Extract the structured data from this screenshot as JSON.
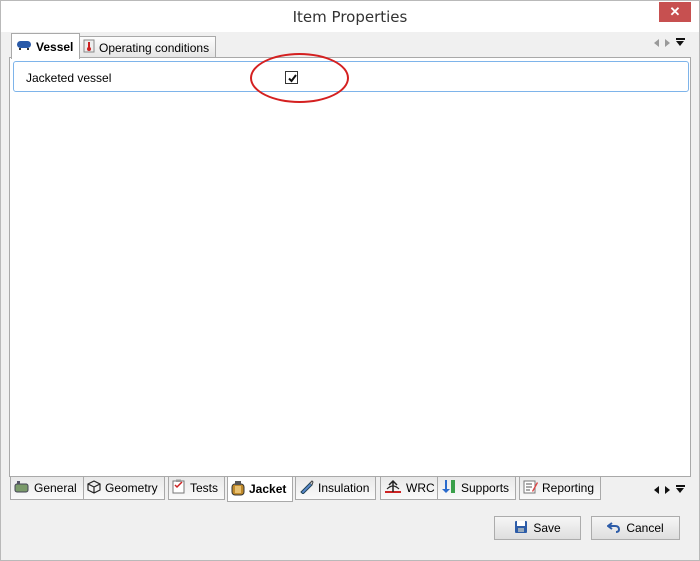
{
  "window": {
    "title": "Item Properties"
  },
  "top_tabs": [
    {
      "label": "Vessel",
      "icon": "vessel-icon",
      "active": true
    },
    {
      "label": "Operating conditions",
      "icon": "thermometer-icon",
      "active": false
    }
  ],
  "property": {
    "label": "Jacketed vessel",
    "checked": true
  },
  "bottom_tabs": [
    {
      "label": "General",
      "icon": "general-icon",
      "active": false
    },
    {
      "label": "Geometry",
      "icon": "geometry-icon",
      "active": false
    },
    {
      "label": "Tests",
      "icon": "tests-icon",
      "active": false
    },
    {
      "label": "Jacket",
      "icon": "jacket-icon",
      "active": true
    },
    {
      "label": "Insulation",
      "icon": "insulation-icon",
      "active": false
    },
    {
      "label": "WRC",
      "icon": "wrc-icon",
      "active": false
    },
    {
      "label": "Supports",
      "icon": "supports-icon",
      "active": false
    },
    {
      "label": "Reporting",
      "icon": "reporting-icon",
      "active": false
    }
  ],
  "buttons": {
    "save": "Save",
    "cancel": "Cancel"
  },
  "colors": {
    "annotation": "#d42020",
    "row_border": "#7eb4ea",
    "close": "#c75050"
  }
}
